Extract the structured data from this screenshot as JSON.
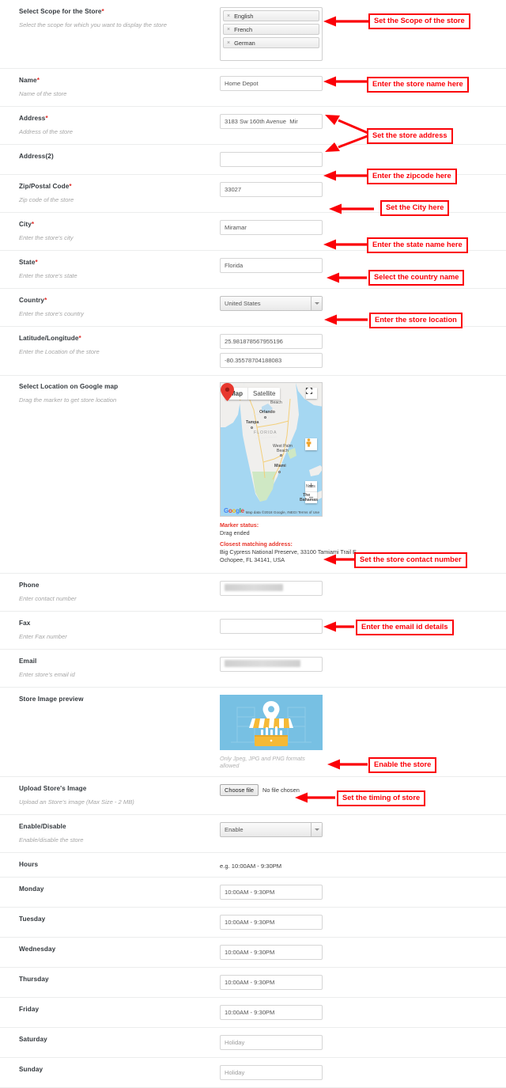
{
  "form": {
    "scope": {
      "label": "Select Scope for the Store",
      "required": "*",
      "hint": "Select the scope for which you want to display the store",
      "chips": [
        "English",
        "French",
        "German"
      ],
      "remove_glyph": "×"
    },
    "name": {
      "label": "Name",
      "required": "*",
      "hint": "Name of the store",
      "value": "Home Depot"
    },
    "address": {
      "label": "Address",
      "required": "*",
      "hint": "Address of the store",
      "value": "3183 Sw 160th Avenue  Mir"
    },
    "address2": {
      "label": "Address(2)",
      "required": "",
      "hint": "",
      "value": ""
    },
    "zip": {
      "label": "Zip/Postal Code",
      "required": "*",
      "hint": "Zip code of the store",
      "value": "33027"
    },
    "city": {
      "label": "City",
      "required": "*",
      "hint": "Enter the store's city",
      "value": "Miramar"
    },
    "state": {
      "label": "State",
      "required": "*",
      "hint": "Enter the store's state",
      "value": "Florida"
    },
    "country": {
      "label": "Country",
      "required": "*",
      "hint": "Enter the store's country",
      "value": "United States"
    },
    "latlng": {
      "label": "Latitude/Longitude",
      "required": "*",
      "hint": "Enter the Location of the store",
      "latitude": "25.981878567955196",
      "longitude": "-80.35578704188083"
    },
    "map": {
      "label": "Select Location on Google map",
      "hint": "Drag the marker to get store location",
      "type_map": "Map",
      "type_satellite": "Satellite",
      "logo": "Google",
      "attribution": "Map data ©2018 Google, INEGI   Terms of Use",
      "zoom_in": "+",
      "zoom_out": "−",
      "place_labels": [
        "Orlando",
        "Tampa",
        "FLORIDA",
        "West Palm",
        "Beach",
        "Miami",
        "Beach",
        "Nass",
        "The",
        "Bahamas"
      ],
      "marker_status_label": "Marker status:",
      "marker_status_value": "Drag ended",
      "closest_label": "Closest matching address:",
      "closest_line1": "Big Cypress National Preserve, 33100 Tamiami Trail E,",
      "closest_line2": "Ochopee, FL 34141, USA"
    },
    "phone": {
      "label": "Phone",
      "required": "",
      "hint": "Enter contact number",
      "value": ""
    },
    "fax": {
      "label": "Fax",
      "required": "",
      "hint": "Enter Fax number",
      "value": ""
    },
    "email": {
      "label": "Email",
      "required": "",
      "hint": "Enter store's email id",
      "value": ""
    },
    "image_preview": {
      "label": "Store Image preview",
      "note": "Only Jpeg, JPG and PNG formats allowed"
    },
    "upload": {
      "label": "Upload Store's Image",
      "hint": "Upload an Store's image (Max Size - 2 MB)",
      "button": "Choose file",
      "status": "No file chosen"
    },
    "enable": {
      "label": "Enable/Disable",
      "required": "",
      "hint": "Enable/disable the store",
      "value": "Enable"
    },
    "hours": {
      "label": "Hours",
      "example": "e.g. 10:00AM - 9:30PM"
    },
    "days": [
      {
        "label": "Monday",
        "value": "10:00AM - 9:30PM",
        "placeholder": false
      },
      {
        "label": "Tuesday",
        "value": "10:00AM - 9:30PM",
        "placeholder": false
      },
      {
        "label": "Wednesday",
        "value": "10:00AM - 9:30PM",
        "placeholder": false
      },
      {
        "label": "Thursday",
        "value": "10:00AM - 9:30PM",
        "placeholder": false
      },
      {
        "label": "Friday",
        "value": "10:00AM - 9:30PM",
        "placeholder": false
      },
      {
        "label": "Saturday",
        "value": "Holiday",
        "placeholder": true
      },
      {
        "label": "Sunday",
        "value": "Holiday",
        "placeholder": true
      }
    ]
  },
  "annotations": [
    {
      "text": "Set the Scope of the store"
    },
    {
      "text": "Enter the store name here"
    },
    {
      "text": "Set the store address"
    },
    {
      "text": "Enter the zipcode here"
    },
    {
      "text": "Set the City here"
    },
    {
      "text": "Enter the state name here"
    },
    {
      "text": "Select the country name"
    },
    {
      "text": "Enter the store location"
    },
    {
      "text": "Set the store contact number"
    },
    {
      "text": "Enter the email id details"
    },
    {
      "text": "Enable the store"
    },
    {
      "text": "Set the timing of store"
    }
  ],
  "colors": {
    "annotation": "#fb0007",
    "required": "#e02b27",
    "label": "#34393e",
    "hint": "#a6a6a6",
    "border": "#eceded",
    "map_water": "#a5d7f2",
    "map_land": "#f0efed",
    "marker": "#e8382f",
    "preview_bg": "#77c0e3",
    "preview_accent": "#f5b936"
  }
}
